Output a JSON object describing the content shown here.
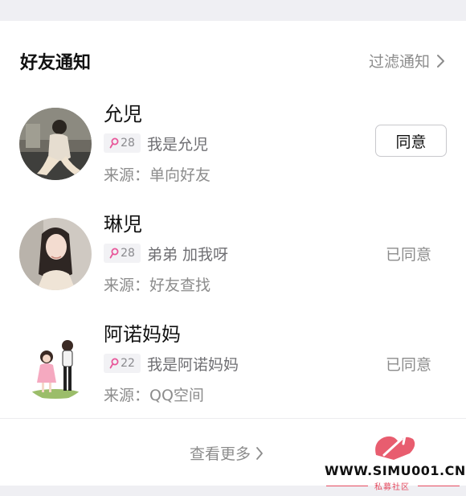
{
  "header": {
    "title": "好友通知",
    "filter_label": "过滤通知"
  },
  "notifications": [
    {
      "name": "允児",
      "age": "28",
      "message": "我是允児",
      "source": "来源：单向好友",
      "action": "同意",
      "status": ""
    },
    {
      "name": "琳児",
      "age": "28",
      "message": "弟弟 加我呀",
      "source": "来源：好友查找",
      "action": "",
      "status": "已同意"
    },
    {
      "name": "阿诺妈妈",
      "age": "22",
      "message": "我是阿诺妈妈",
      "source": "来源：QQ空间",
      "action": "",
      "status": "已同意"
    }
  ],
  "footer": {
    "more_label": "查看更多"
  },
  "watermark": {
    "site": "WWW.SIMU001.CN",
    "subtitle": "私募社区"
  },
  "colors": {
    "badge_icon": "#e8579a",
    "watermark_red": "#e54b5f"
  }
}
